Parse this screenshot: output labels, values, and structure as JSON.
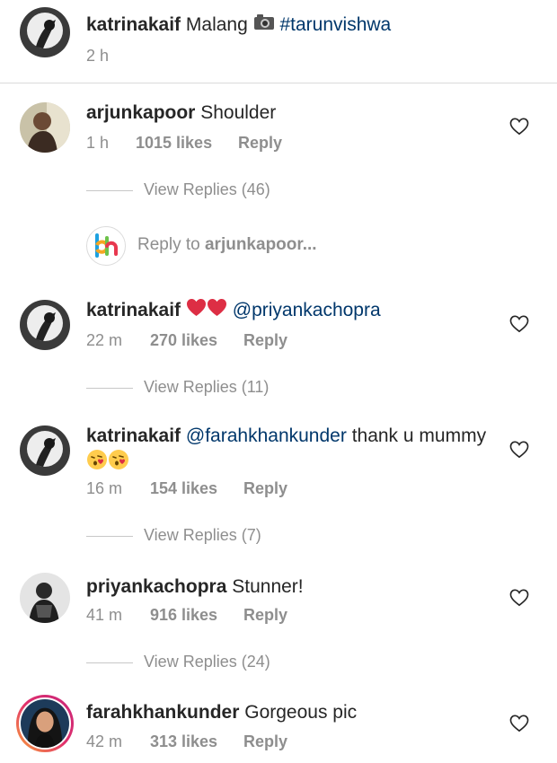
{
  "caption": {
    "username": "katrinakaif",
    "text": "Malang",
    "hashtag": "#tarunvishwa",
    "time": "2 h"
  },
  "comments": [
    {
      "username": "arjunkapoor",
      "text": "Shoulder",
      "time": "1 h",
      "likes": "1015 likes",
      "reply": "Reply",
      "view_replies": "View Replies (46)"
    },
    {
      "username": "katrinakaif",
      "mention": "@priyankachopra",
      "time": "22 m",
      "likes": "270 likes",
      "reply": "Reply",
      "view_replies": "View Replies (11)"
    },
    {
      "username": "katrinakaif",
      "mention": "@farahkhankunder",
      "text": "thank u mummy",
      "time": "16 m",
      "likes": "154 likes",
      "reply": "Reply",
      "view_replies": "View Replies (7)"
    },
    {
      "username": "priyankachopra",
      "text": "Stunner!",
      "time": "41 m",
      "likes": "916 likes",
      "reply": "Reply",
      "view_replies": "View Replies (24)"
    },
    {
      "username": "farahkhankunder",
      "text": "Gorgeous pic",
      "time": "42 m",
      "likes": "313 likes",
      "reply": "Reply"
    }
  ],
  "reply_box": {
    "prefix": "Reply to ",
    "target": "arjunkapoor...",
    "logo": "bh"
  },
  "icons": {
    "heart": "heart-outline-icon",
    "camera": "camera-emoji",
    "red_heart": "red-heart-emoji",
    "kiss": "face-blowing-kiss-emoji"
  },
  "colors": {
    "mention": "#00376b",
    "meta": "#8e8e8e",
    "story_ring_start": "#f9a23a",
    "story_ring_end": "#c7267a"
  }
}
